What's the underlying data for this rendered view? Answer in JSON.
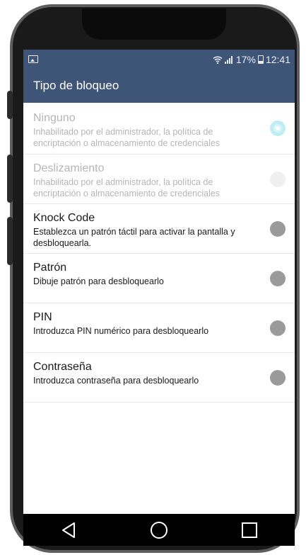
{
  "status_bar": {
    "battery": "17%",
    "time": "12:41",
    "icons": [
      "image-notification-icon",
      "wifi-icon",
      "signal-icon",
      "battery-icon"
    ]
  },
  "header": {
    "title": "Tipo de bloqueo"
  },
  "options": [
    {
      "title": "Ninguno",
      "description": "Inhabilitado por el administrador, la política de encriptación o almacenamiento de credenciales",
      "enabled": false,
      "selected": true
    },
    {
      "title": "Deslizamiento",
      "description": "Inhabilitado por el administrador, la política de encriptación o almacenamiento de credenciales",
      "enabled": false,
      "selected": false
    },
    {
      "title": "Knock Code",
      "description": "Establezca un patrón táctil para activar la pantalla y desbloquearla.",
      "enabled": true,
      "selected": false
    },
    {
      "title": "Patrón",
      "description": "Dibuje patrón para desbloquearlo",
      "enabled": true,
      "selected": false
    },
    {
      "title": "PIN",
      "description": "Introduzca PIN numérico para desbloquearlo",
      "enabled": true,
      "selected": false
    },
    {
      "title": "Contraseña",
      "description": "Introduzca contraseña para desbloquearlo",
      "enabled": true,
      "selected": false
    }
  ],
  "navigation": {
    "buttons": [
      "back-icon",
      "home-icon",
      "recents-icon"
    ]
  },
  "colors": {
    "header_bg": "#3f5577",
    "disabled_text": "#b5b5b5",
    "radio": "#9a9a9a",
    "selected_disabled_radio": "#bfeef2"
  }
}
